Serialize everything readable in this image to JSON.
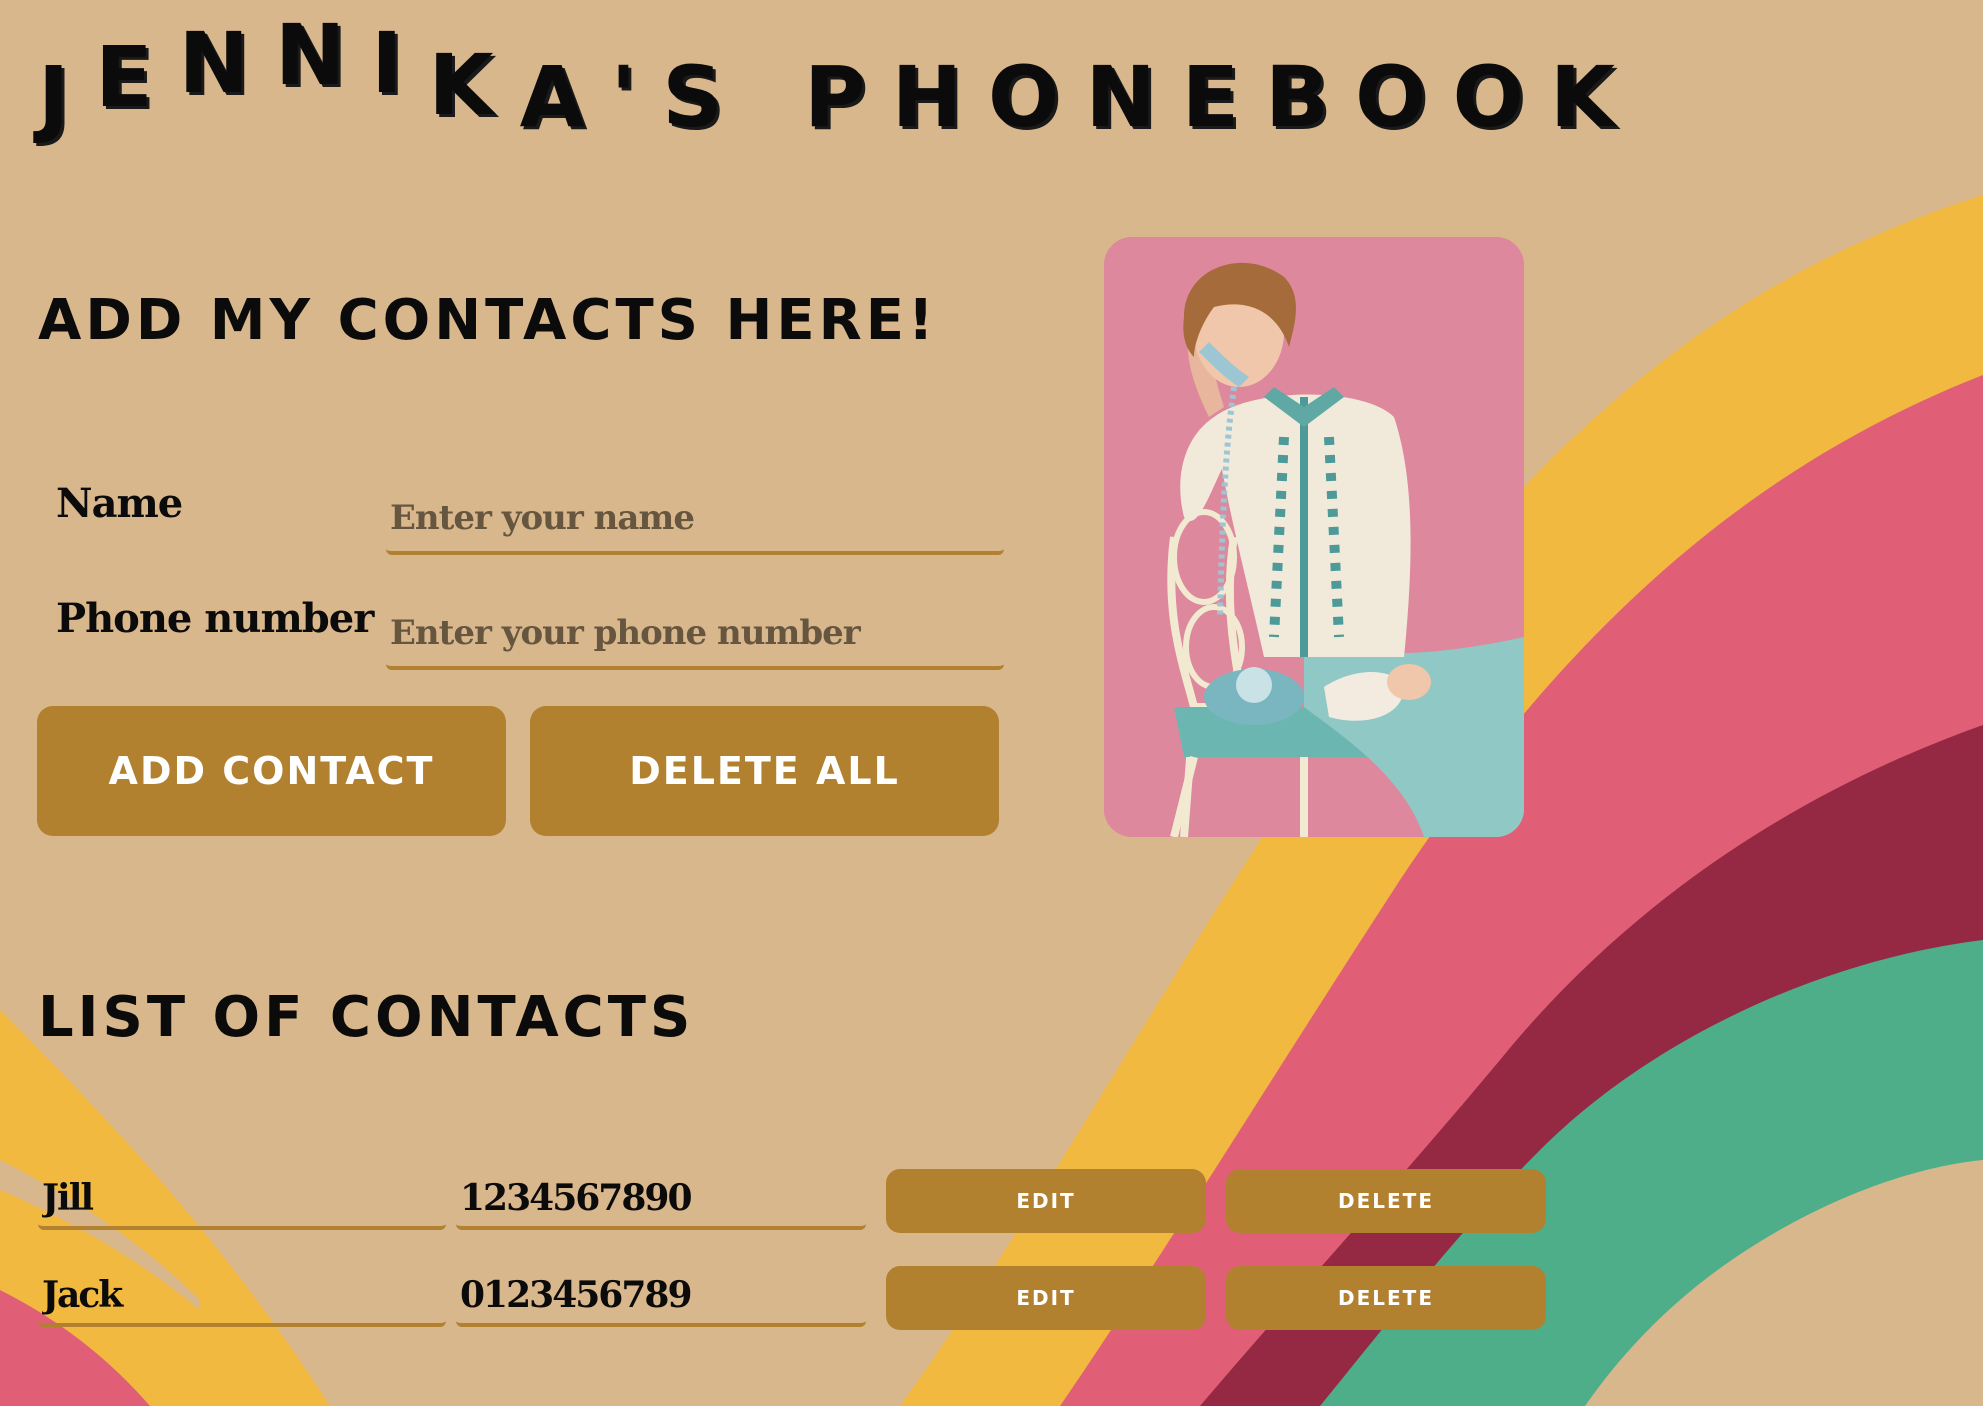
{
  "title": "JENNIKA'S PHONEBOOK",
  "form": {
    "heading": "ADD MY CONTACTS HERE!",
    "name_label": "Name",
    "name_placeholder": "Enter your name",
    "phone_label": "Phone number",
    "phone_placeholder": "Enter your phone number",
    "add_button": "ADD CONTACT",
    "delete_all_button": "DELETE ALL"
  },
  "list": {
    "heading": "LIST OF CONTACTS",
    "contacts": [
      {
        "name": "Jill",
        "phone": "1234567890",
        "edit_label": "EDIT",
        "delete_label": "DELETE"
      },
      {
        "name": "Jack",
        "phone": "0123456789",
        "edit_label": "EDIT",
        "delete_label": "DELETE"
      }
    ]
  },
  "colors": {
    "background": "#d9b78c",
    "button": "#b2812f",
    "stripe_yellow": "#f2b941",
    "stripe_pink": "#e05f76",
    "stripe_maroon": "#952842",
    "stripe_green": "#4eae89"
  },
  "icons": {
    "photo": "vintage-woman-on-phone-photo"
  }
}
